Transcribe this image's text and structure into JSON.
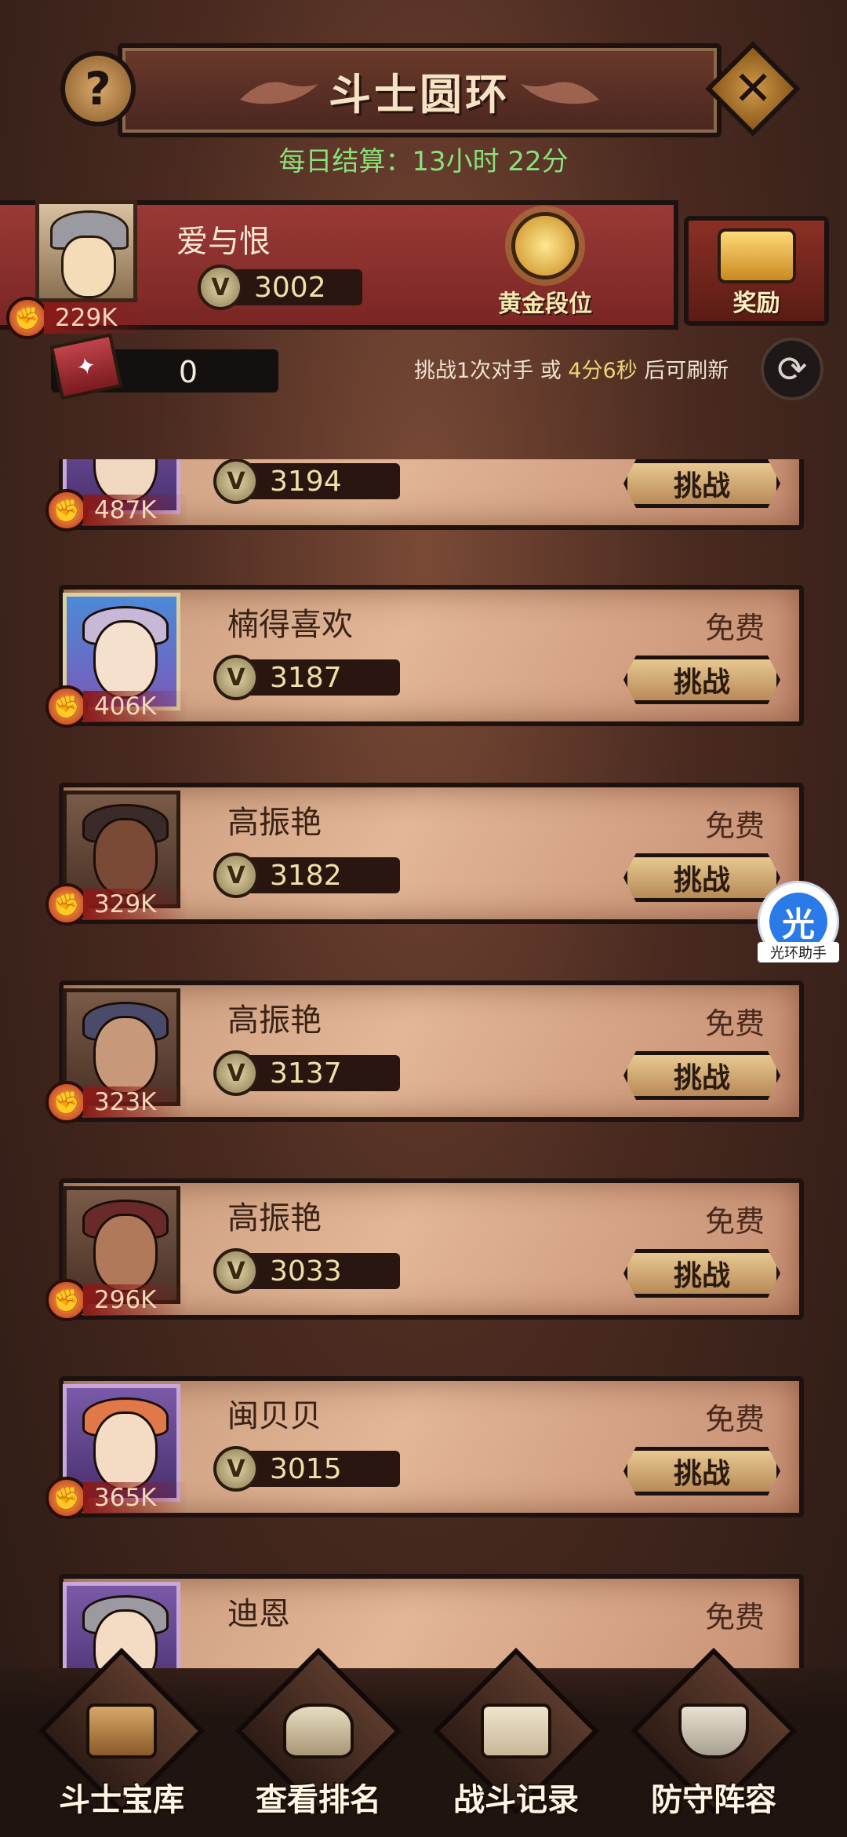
{
  "header": {
    "title": "斗士圆环",
    "help_symbol": "?",
    "close_symbol": "✕",
    "daily_settle": "每日结算：13小时 22分"
  },
  "player": {
    "name": "爱与恨",
    "score": "3002",
    "power": "229K",
    "rank_label": "黄金段位",
    "reward_label": "奖励"
  },
  "tickets": {
    "count": "0"
  },
  "refresh": {
    "prefix": "挑战1次对手 或 ",
    "time": "4分6秒",
    "suffix": " 后可刷新"
  },
  "opponents": [
    {
      "name": "",
      "score": "3194",
      "power": "487K",
      "status": "",
      "action": "挑战"
    },
    {
      "name": "楠得喜欢",
      "score": "3187",
      "power": "406K",
      "status": "免费",
      "action": "挑战"
    },
    {
      "name": "高振艳",
      "score": "3182",
      "power": "329K",
      "status": "免费",
      "action": "挑战"
    },
    {
      "name": "高振艳",
      "score": "3137",
      "power": "323K",
      "status": "免费",
      "action": "挑战"
    },
    {
      "name": "高振艳",
      "score": "3033",
      "power": "296K",
      "status": "免费",
      "action": "挑战"
    },
    {
      "name": "闽贝贝",
      "score": "3015",
      "power": "365K",
      "status": "免费",
      "action": "挑战"
    },
    {
      "name": "迪恩",
      "score": "",
      "power": "",
      "status": "免费",
      "action": ""
    }
  ],
  "helper": {
    "glyph": "光",
    "caption": "光环助手"
  },
  "nav": [
    {
      "label": "斗士宝库"
    },
    {
      "label": "查看排名"
    },
    {
      "label": "战斗记录"
    },
    {
      "label": "防守阵容"
    }
  ],
  "colors": {
    "settle_text": "#8be07a",
    "refresh_time": "#e8d47a",
    "banner_red": "#9a3a36"
  }
}
